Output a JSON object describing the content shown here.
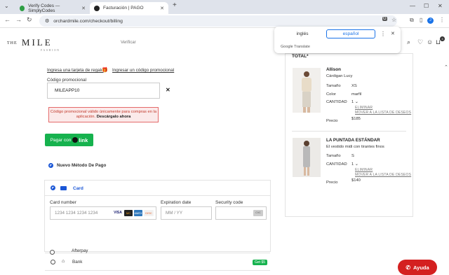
{
  "browser": {
    "tabs": [
      {
        "title": "Verify Codes — SimplyCodes",
        "favicon_color": "#2e9e44"
      },
      {
        "title": "Facturación | PAGO",
        "favicon_color": "#222222"
      }
    ],
    "new_tab": "+",
    "url": "orchardmile.com/checkout/billing"
  },
  "translate": {
    "lang_source": "inglés",
    "lang_target": "español",
    "brand": "Google Translate"
  },
  "header": {
    "logo_left": "THE",
    "logo_main": "MILE",
    "logo_sub": "FASHION",
    "progress_step": "Verificar",
    "cart_badge": "3"
  },
  "checkout": {
    "gift_card_link": "Ingresa una tarjeta de regalo",
    "promo_link": "Ingresar un código promocional",
    "promo_label": "Código promocional",
    "promo_value": "MILEAPP10",
    "promo_clear": "✕",
    "alert_text": "Código promocional válido únicamente para compras en la aplicación.",
    "alert_link": "Descárgalo ahora",
    "pay_button_prefix": "Pagar con",
    "pay_button_brand": "link",
    "new_method_label": "Nuevo Método De Pago",
    "payment_methods": {
      "card_label": "Card",
      "card_number_label": "Card number",
      "card_number_placeholder": "1234 1234 1234 1234",
      "expiration_label": "Expiration date",
      "expiration_placeholder": "MM / YY",
      "security_label": "Security code",
      "security_placeholder": "CVC",
      "card_brands": [
        "VISA",
        "MC",
        "AMEX",
        "DISC"
      ],
      "bank_label": "Bank",
      "bank_badge": "Get $5",
      "afterpay_label": "Afterpay"
    }
  },
  "summary": {
    "total_label": "TOTAL*",
    "items": [
      {
        "brand": "Allison",
        "name": "Cárdigan Lucy",
        "size_label": "Tamaño",
        "size": "XS",
        "color_label": "Color",
        "color": "marfil",
        "qty_label": "CANTIDAD",
        "qty": "1",
        "remove": "ELIMINAR",
        "move": "MOVER A LA LISTA DE DESEOS",
        "price_label": "Precio",
        "price": "$185"
      },
      {
        "brand": "LA PUNTADA ESTÁNDAR",
        "name": "El vestido midi con tirantes finos",
        "size_label": "Tamaño",
        "size": "S",
        "qty_label": "CANTIDAD",
        "qty": "1",
        "remove": "ELIMINAR",
        "move": "MOVER A LA LISTA DE DESEOS",
        "price_label": "Precio",
        "price": "$140"
      }
    ]
  },
  "help_button": "Ayuda",
  "colors": {
    "accent_green": "#16b24e",
    "accent_blue": "#1a56d6",
    "alert_red": "#e46a6a",
    "help_red": "#d42020"
  }
}
